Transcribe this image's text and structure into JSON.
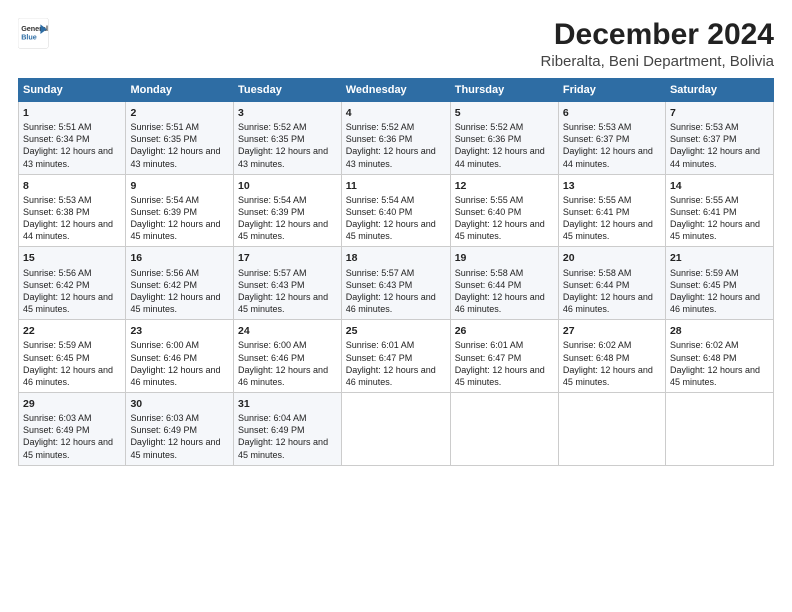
{
  "header": {
    "logo_line1": "General",
    "logo_line2": "Blue",
    "title": "December 2024",
    "subtitle": "Riberalta, Beni Department, Bolivia"
  },
  "weekdays": [
    "Sunday",
    "Monday",
    "Tuesday",
    "Wednesday",
    "Thursday",
    "Friday",
    "Saturday"
  ],
  "weeks": [
    [
      {
        "day": "1",
        "sunrise": "Sunrise: 5:51 AM",
        "sunset": "Sunset: 6:34 PM",
        "daylight": "Daylight: 12 hours and 43 minutes."
      },
      {
        "day": "2",
        "sunrise": "Sunrise: 5:51 AM",
        "sunset": "Sunset: 6:35 PM",
        "daylight": "Daylight: 12 hours and 43 minutes."
      },
      {
        "day": "3",
        "sunrise": "Sunrise: 5:52 AM",
        "sunset": "Sunset: 6:35 PM",
        "daylight": "Daylight: 12 hours and 43 minutes."
      },
      {
        "day": "4",
        "sunrise": "Sunrise: 5:52 AM",
        "sunset": "Sunset: 6:36 PM",
        "daylight": "Daylight: 12 hours and 43 minutes."
      },
      {
        "day": "5",
        "sunrise": "Sunrise: 5:52 AM",
        "sunset": "Sunset: 6:36 PM",
        "daylight": "Daylight: 12 hours and 44 minutes."
      },
      {
        "day": "6",
        "sunrise": "Sunrise: 5:53 AM",
        "sunset": "Sunset: 6:37 PM",
        "daylight": "Daylight: 12 hours and 44 minutes."
      },
      {
        "day": "7",
        "sunrise": "Sunrise: 5:53 AM",
        "sunset": "Sunset: 6:37 PM",
        "daylight": "Daylight: 12 hours and 44 minutes."
      }
    ],
    [
      {
        "day": "8",
        "sunrise": "Sunrise: 5:53 AM",
        "sunset": "Sunset: 6:38 PM",
        "daylight": "Daylight: 12 hours and 44 minutes."
      },
      {
        "day": "9",
        "sunrise": "Sunrise: 5:54 AM",
        "sunset": "Sunset: 6:39 PM",
        "daylight": "Daylight: 12 hours and 45 minutes."
      },
      {
        "day": "10",
        "sunrise": "Sunrise: 5:54 AM",
        "sunset": "Sunset: 6:39 PM",
        "daylight": "Daylight: 12 hours and 45 minutes."
      },
      {
        "day": "11",
        "sunrise": "Sunrise: 5:54 AM",
        "sunset": "Sunset: 6:40 PM",
        "daylight": "Daylight: 12 hours and 45 minutes."
      },
      {
        "day": "12",
        "sunrise": "Sunrise: 5:55 AM",
        "sunset": "Sunset: 6:40 PM",
        "daylight": "Daylight: 12 hours and 45 minutes."
      },
      {
        "day": "13",
        "sunrise": "Sunrise: 5:55 AM",
        "sunset": "Sunset: 6:41 PM",
        "daylight": "Daylight: 12 hours and 45 minutes."
      },
      {
        "day": "14",
        "sunrise": "Sunrise: 5:55 AM",
        "sunset": "Sunset: 6:41 PM",
        "daylight": "Daylight: 12 hours and 45 minutes."
      }
    ],
    [
      {
        "day": "15",
        "sunrise": "Sunrise: 5:56 AM",
        "sunset": "Sunset: 6:42 PM",
        "daylight": "Daylight: 12 hours and 45 minutes."
      },
      {
        "day": "16",
        "sunrise": "Sunrise: 5:56 AM",
        "sunset": "Sunset: 6:42 PM",
        "daylight": "Daylight: 12 hours and 45 minutes."
      },
      {
        "day": "17",
        "sunrise": "Sunrise: 5:57 AM",
        "sunset": "Sunset: 6:43 PM",
        "daylight": "Daylight: 12 hours and 45 minutes."
      },
      {
        "day": "18",
        "sunrise": "Sunrise: 5:57 AM",
        "sunset": "Sunset: 6:43 PM",
        "daylight": "Daylight: 12 hours and 46 minutes."
      },
      {
        "day": "19",
        "sunrise": "Sunrise: 5:58 AM",
        "sunset": "Sunset: 6:44 PM",
        "daylight": "Daylight: 12 hours and 46 minutes."
      },
      {
        "day": "20",
        "sunrise": "Sunrise: 5:58 AM",
        "sunset": "Sunset: 6:44 PM",
        "daylight": "Daylight: 12 hours and 46 minutes."
      },
      {
        "day": "21",
        "sunrise": "Sunrise: 5:59 AM",
        "sunset": "Sunset: 6:45 PM",
        "daylight": "Daylight: 12 hours and 46 minutes."
      }
    ],
    [
      {
        "day": "22",
        "sunrise": "Sunrise: 5:59 AM",
        "sunset": "Sunset: 6:45 PM",
        "daylight": "Daylight: 12 hours and 46 minutes."
      },
      {
        "day": "23",
        "sunrise": "Sunrise: 6:00 AM",
        "sunset": "Sunset: 6:46 PM",
        "daylight": "Daylight: 12 hours and 46 minutes."
      },
      {
        "day": "24",
        "sunrise": "Sunrise: 6:00 AM",
        "sunset": "Sunset: 6:46 PM",
        "daylight": "Daylight: 12 hours and 46 minutes."
      },
      {
        "day": "25",
        "sunrise": "Sunrise: 6:01 AM",
        "sunset": "Sunset: 6:47 PM",
        "daylight": "Daylight: 12 hours and 46 minutes."
      },
      {
        "day": "26",
        "sunrise": "Sunrise: 6:01 AM",
        "sunset": "Sunset: 6:47 PM",
        "daylight": "Daylight: 12 hours and 45 minutes."
      },
      {
        "day": "27",
        "sunrise": "Sunrise: 6:02 AM",
        "sunset": "Sunset: 6:48 PM",
        "daylight": "Daylight: 12 hours and 45 minutes."
      },
      {
        "day": "28",
        "sunrise": "Sunrise: 6:02 AM",
        "sunset": "Sunset: 6:48 PM",
        "daylight": "Daylight: 12 hours and 45 minutes."
      }
    ],
    [
      {
        "day": "29",
        "sunrise": "Sunrise: 6:03 AM",
        "sunset": "Sunset: 6:49 PM",
        "daylight": "Daylight: 12 hours and 45 minutes."
      },
      {
        "day": "30",
        "sunrise": "Sunrise: 6:03 AM",
        "sunset": "Sunset: 6:49 PM",
        "daylight": "Daylight: 12 hours and 45 minutes."
      },
      {
        "day": "31",
        "sunrise": "Sunrise: 6:04 AM",
        "sunset": "Sunset: 6:49 PM",
        "daylight": "Daylight: 12 hours and 45 minutes."
      },
      null,
      null,
      null,
      null
    ]
  ]
}
